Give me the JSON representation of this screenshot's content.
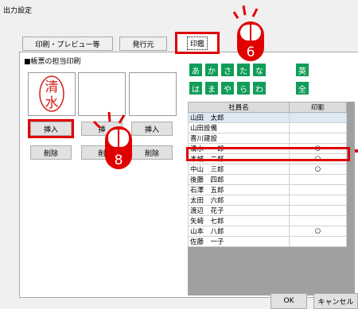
{
  "window": {
    "title": "出力設定"
  },
  "tabs": [
    {
      "label": "印刷・プレビュー等"
    },
    {
      "label": "発行元"
    },
    {
      "label": "印鑑"
    }
  ],
  "group": {
    "label": "■帳票の担当印刷"
  },
  "stamp": {
    "char1": "清",
    "char2": "水"
  },
  "buttons": {
    "insert": "挿入",
    "delete": "削除",
    "insert_partial": "挿",
    "delete_partial": "削"
  },
  "kana_row1": [
    "あ",
    "か",
    "さ",
    "た",
    "な",
    "英"
  ],
  "kana_row2": [
    "は",
    "ま",
    "や",
    "ら",
    "わ",
    "全"
  ],
  "table": {
    "headers": [
      "社員名",
      "印影"
    ],
    "rows": [
      {
        "name": "山田　太郎",
        "mark": ""
      },
      {
        "name": "山田設備",
        "mark": ""
      },
      {
        "name": "喜川建設",
        "mark": ""
      },
      {
        "name": "清水　一郎",
        "mark": "○"
      },
      {
        "name": "本城　二郎",
        "mark": "○"
      },
      {
        "name": "中山　三郎",
        "mark": "○"
      },
      {
        "name": "後藤　四郎",
        "mark": ""
      },
      {
        "name": "石澤　五郎",
        "mark": ""
      },
      {
        "name": "太田　六郎",
        "mark": ""
      },
      {
        "name": "渡辺　花子",
        "mark": ""
      },
      {
        "name": "矢崎　七郎",
        "mark": ""
      },
      {
        "name": "山本　八郎",
        "mark": "○"
      },
      {
        "name": "佐藤　一子",
        "mark": ""
      }
    ]
  },
  "callouts": {
    "six": "6",
    "eight": "8"
  },
  "footer": {
    "ok": "OK",
    "cancel": "キャンセル"
  },
  "colors": {
    "kana_green": "#0f9d58",
    "highlight_red": "#e00000",
    "stamp_red": "#d02020"
  }
}
